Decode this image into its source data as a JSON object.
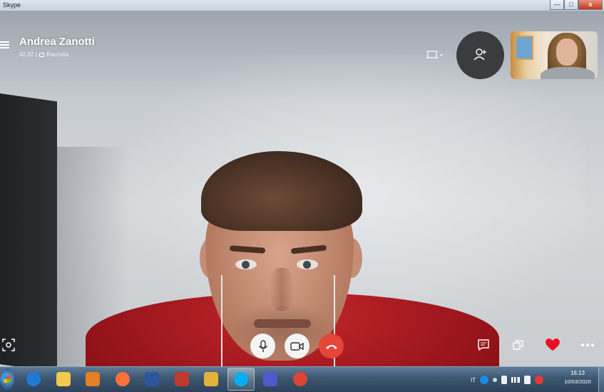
{
  "window": {
    "title": "Skype",
    "minimize_label": "—",
    "maximize_label": "□",
    "close_label": "x"
  },
  "call": {
    "caller_name": "Andrea Zanotti",
    "duration": "42:32",
    "separator": "|",
    "conversation_label": "Raccolta"
  },
  "controls": {
    "mic_icon": "microphone-icon",
    "camera_icon": "video-camera-icon",
    "end_call_icon": "hang-up-icon",
    "react_icon": "heart-icon",
    "more_icon": "more-dots-icon"
  },
  "colors": {
    "end_call": "#e64539",
    "heart": "#e81123",
    "add_person_bg": "#3a3d40"
  },
  "taskbar": {
    "apps": [
      {
        "name": "internet-explorer",
        "color": "#1e7ad4"
      },
      {
        "name": "file-explorer",
        "color": "#f2c94c"
      },
      {
        "name": "media-player",
        "color": "#e67e22"
      },
      {
        "name": "firefox",
        "color": "#ff7139"
      },
      {
        "name": "word",
        "color": "#2b579a"
      },
      {
        "name": "paint",
        "color": "#c0392b"
      },
      {
        "name": "outlook",
        "color": "#e2b23a"
      },
      {
        "name": "skype",
        "color": "#00aff0"
      },
      {
        "name": "teams",
        "color": "#5059c9"
      },
      {
        "name": "chrome",
        "color": "#db4437"
      }
    ],
    "tray": {
      "language": "IT",
      "time": "16:13",
      "date": "10/03/2020"
    }
  }
}
